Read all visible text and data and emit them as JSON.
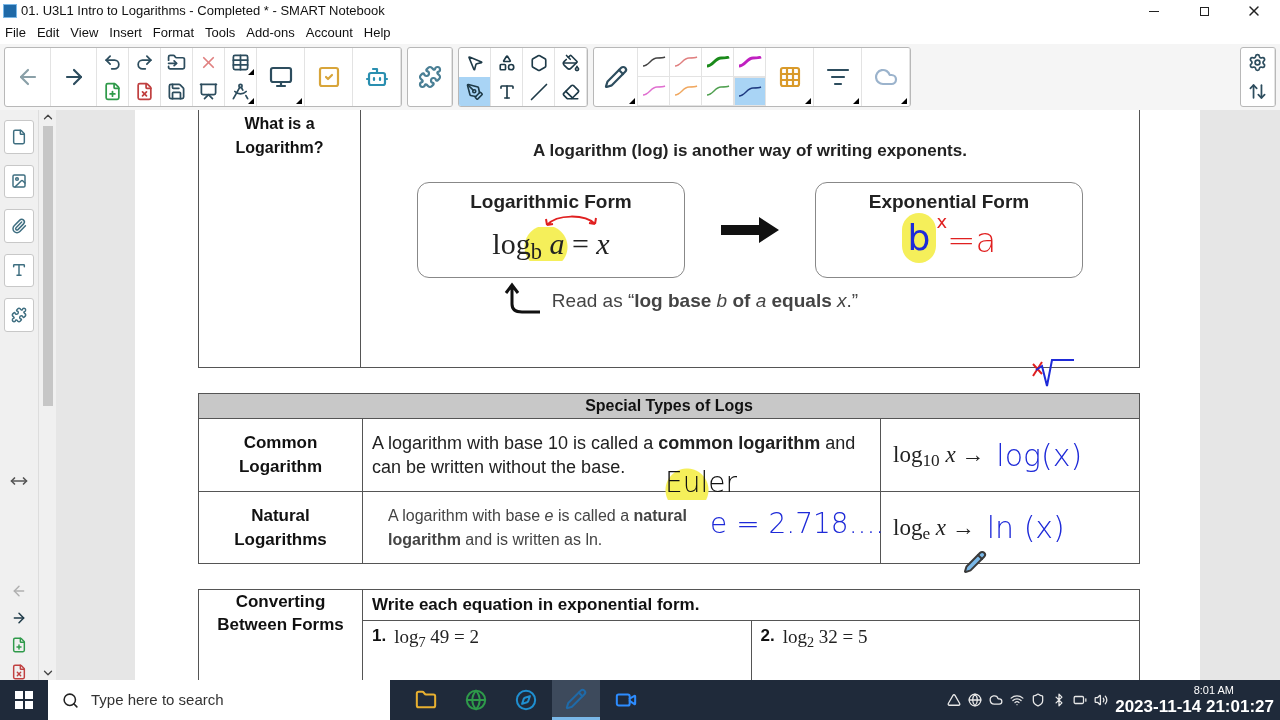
{
  "window": {
    "title": "01. U3L1 Intro to Logarithms - Completed * - SMART Notebook"
  },
  "menu": [
    "File",
    "Edit",
    "View",
    "Insert",
    "Format",
    "Tools",
    "Add-ons",
    "Account",
    "Help"
  ],
  "tools": [
    {
      "selected": false
    },
    {
      "selected": false
    },
    {
      "selected": false
    },
    {
      "selected": false
    },
    {
      "selected": true
    },
    {
      "selected": false
    },
    {
      "selected": false
    },
    {
      "selected": false
    }
  ],
  "pen_styles": [
    {
      "color": "#444444",
      "selected": false
    },
    {
      "color": "#e08080",
      "selected": false
    },
    {
      "color": "#1a8a1a",
      "selected": false
    },
    {
      "color": "#c020c0",
      "selected": false
    },
    {
      "color": "#e070d0",
      "selected": false
    },
    {
      "color": "#f0a860",
      "selected": false
    },
    {
      "color": "#50a050",
      "selected": false
    },
    {
      "color": "#1f3a80",
      "selected": true
    }
  ],
  "page": {
    "definition": {
      "heading": "What is a Logarithm?",
      "intro": "A logarithm (log) is another way of writing exponents.",
      "log_form": {
        "title": "Logarithmic Form",
        "expression": "log$_{b}$ *a* = *x*"
      },
      "exp_form": {
        "title": "Exponential Form",
        "base": "b",
        "exponent": "x",
        "rest": "=a"
      },
      "read_as": "Read as “**log base** *b* **of** *a* **equals** *x*.”"
    },
    "special": {
      "title": "Special Types of Logs",
      "rows": [
        {
          "name": "Common Logarithm",
          "description": "A logarithm with base 10 is called a **common logarithm** and can be written without the base.",
          "notation": "log$_{10}$ *x* →",
          "handwritten": "log(x)"
        },
        {
          "name": "Natural Logarithms",
          "description": "A logarithm with base *e* is called a **natural logarithm** and is written as ln.",
          "notation": "log$_{e}$ *x* →",
          "handwritten": "ln (x)"
        }
      ]
    },
    "annotations": [
      {
        "text": "Euler"
      },
      {
        "text": "e = 2.718...."
      }
    ],
    "converting": {
      "heading": "Converting Between Forms",
      "instruction": "Write each equation in exponential form.",
      "problems": [
        {
          "number": "1.",
          "equation": "log$_{7}$ 49 = 2"
        },
        {
          "number": "2.",
          "equation": "log$_{2}$ 32 = 5"
        }
      ]
    }
  },
  "taskbar": {
    "search_placeholder": "Type here to search",
    "apps": [
      {
        "kind": "folder",
        "selected": false
      },
      {
        "kind": "chrome",
        "selected": false
      },
      {
        "kind": "edge",
        "selected": false
      },
      {
        "kind": "notebook",
        "selected": true
      },
      {
        "kind": "zoom",
        "selected": false
      }
    ],
    "time": "8:01 AM",
    "timestamp": "2023-11-14 21:01:27"
  }
}
